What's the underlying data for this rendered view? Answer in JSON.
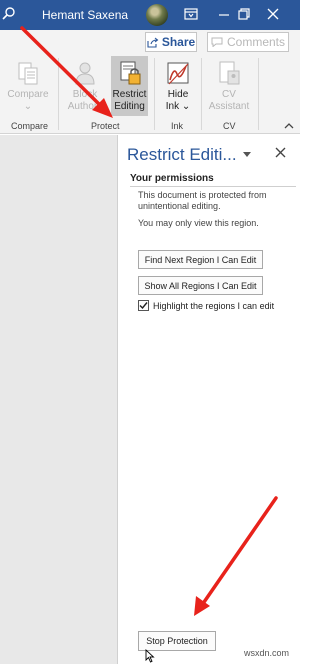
{
  "titlebar": {
    "user_name": "Hemant Saxena"
  },
  "share_row": {
    "share_label": "Share",
    "comments_label": "Comments"
  },
  "ribbon": {
    "buttons": [
      {
        "label_line1": "Compare",
        "label_line2": "",
        "icon": "compare-icon"
      },
      {
        "label_line1": "Block",
        "label_line2": "Authors",
        "icon": "block-authors-icon"
      },
      {
        "label_line1": "Restrict",
        "label_line2": "Editing",
        "icon": "restrict-editing-icon"
      },
      {
        "label_line1": "Hide",
        "label_line2": "Ink",
        "icon": "hide-ink-icon"
      },
      {
        "label_line1": "CV",
        "label_line2": "Assistant",
        "icon": "cv-assistant-icon"
      }
    ],
    "groups": [
      "Compare",
      "Protect",
      "Ink",
      "CV"
    ]
  },
  "pane": {
    "title": "Restrict Editi...",
    "permissions_heading": "Your permissions",
    "protected_text": "This document is protected from unintentional editing.",
    "view_text": "You may only view this region.",
    "find_next_label": "Find Next Region I Can Edit",
    "show_all_label": "Show All Regions I Can Edit",
    "highlight_label": "Highlight the regions I can edit",
    "highlight_checked": true,
    "stop_protection_label": "Stop Protection"
  },
  "watermark": "wsxdn.com",
  "colors": {
    "titlebar": "#2b579a",
    "arrow": "#e8221b",
    "accent": "#2b579a"
  }
}
